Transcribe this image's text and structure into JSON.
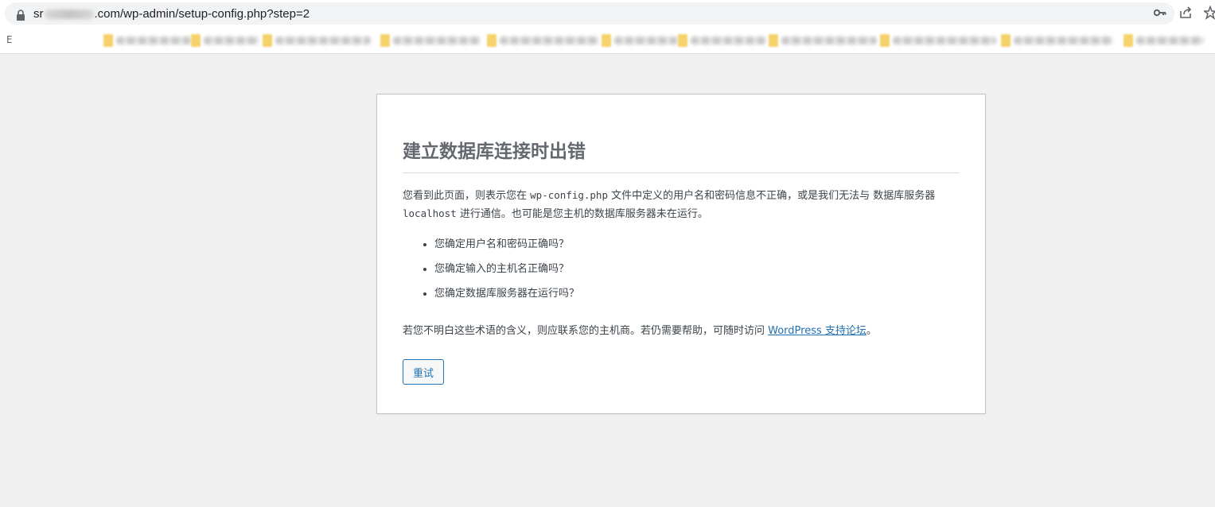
{
  "browser": {
    "url_prefix": "sr",
    "url_suffix": ".com/wp-admin/setup-config.php?step=2",
    "bookmarks_first_label": "E",
    "bookmarks": [
      {
        "label": ""
      },
      {
        "label": ""
      },
      {
        "label": ""
      },
      {
        "label": ""
      },
      {
        "label": ""
      },
      {
        "label": ""
      },
      {
        "label": ""
      },
      {
        "label": ""
      },
      {
        "label": ""
      },
      {
        "label": ""
      },
      {
        "label": ""
      }
    ]
  },
  "page": {
    "title": "建立数据库连接时出错",
    "intro_part1": "您看到此页面，则表示您在 ",
    "intro_code1": "wp-config.php",
    "intro_part2": " 文件中定义的用户名和密码信息不正确，或是我们无法与 数据库服务器 ",
    "intro_code2": "localhost",
    "intro_part3": " 进行通信。也可能是您主机的数据库服务器未在运行。",
    "questions": [
      "您确定用户名和密码正确吗？",
      "您确定输入的主机名正确吗？",
      "您确定数据库服务器在运行吗？"
    ],
    "help_text": "若您不明白这些术语的含义，则应联系您的主机商。若仍需要帮助，可随时访问 ",
    "help_link": "WordPress 支持论坛",
    "help_end": "。",
    "retry_label": "重试"
  },
  "colors": {
    "link": "#2271b1",
    "title": "#646970",
    "background": "#f0f0f1"
  }
}
